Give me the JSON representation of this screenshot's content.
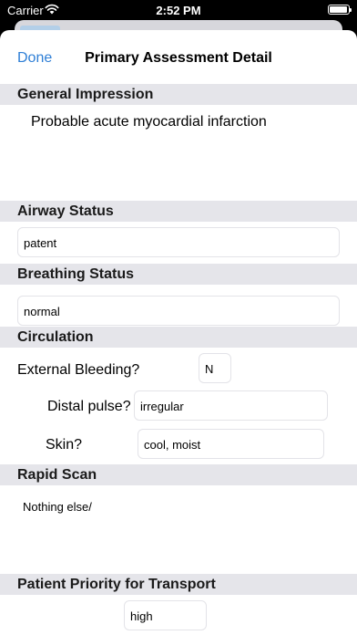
{
  "status_bar": {
    "carrier": "Carrier",
    "time": "2:52 PM",
    "battery_level": 0.95
  },
  "nav": {
    "done_label": "Done",
    "title": "Primary Assessment Detail"
  },
  "general_impression": {
    "header": "General Impression",
    "text": "Probable acute myocardial infarction"
  },
  "airway": {
    "header": "Airway Status",
    "value": "patent"
  },
  "breathing": {
    "header": "Breathing Status",
    "value": "normal"
  },
  "circulation": {
    "header": "Circulation",
    "external_bleeding_label": "External Bleeding?",
    "external_bleeding_value": "N",
    "distal_pulse_label": "Distal pulse?",
    "distal_pulse_value": "irregular",
    "skin_label": "Skin?",
    "skin_value": "cool, moist"
  },
  "rapid_scan": {
    "header": "Rapid Scan",
    "text": "Nothing else/"
  },
  "priority": {
    "header": "Patient Priority for Transport",
    "value": "high"
  },
  "colors": {
    "accent": "#2F7FD6",
    "section_bg": "#E5E5EA",
    "field_border": "#E3E3E8"
  }
}
